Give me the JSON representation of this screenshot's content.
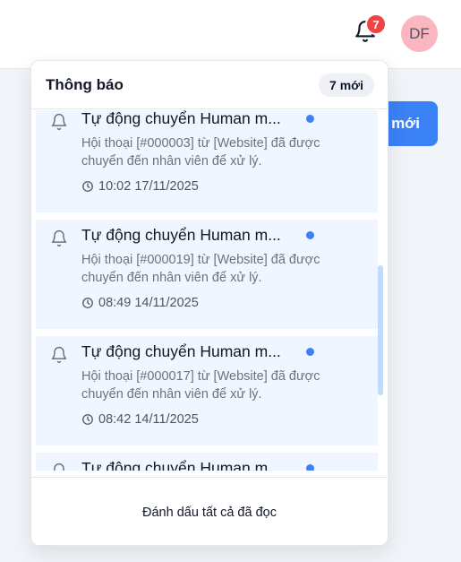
{
  "header": {
    "notification_badge": "7",
    "avatar_initials": "DF",
    "new_button_label": "mới"
  },
  "panel": {
    "title": "Thông báo",
    "new_count_label": "7 mới",
    "mark_all_label": "Đánh dấu tất cả đã đọc",
    "items": [
      {
        "title": "Tự động chuyển Human m...",
        "desc": "Hội thoại [#000003] từ [Website] đã được chuyển đến nhân viên để xử lý.",
        "time": "10:02 17/11/2025"
      },
      {
        "title": "Tự động chuyển Human m...",
        "desc": "Hội thoại [#000019] từ [Website] đã được chuyển đến nhân viên để xử lý.",
        "time": "08:49 14/11/2025"
      },
      {
        "title": "Tự động chuyển Human m...",
        "desc": "Hội thoại [#000017] từ [Website] đã được chuyển đến nhân viên để xử lý.",
        "time": "08:42 14/11/2025"
      },
      {
        "title": "Tự động chuyển Human m...",
        "desc": "",
        "time": ""
      }
    ]
  },
  "icons": {
    "bell": "bell-icon",
    "clock": "clock-icon"
  },
  "colors": {
    "accent": "#3b82f6",
    "badge": "#ef4444",
    "unread_bg": "#eff6ff",
    "avatar_bg": "#fbb6c0"
  }
}
